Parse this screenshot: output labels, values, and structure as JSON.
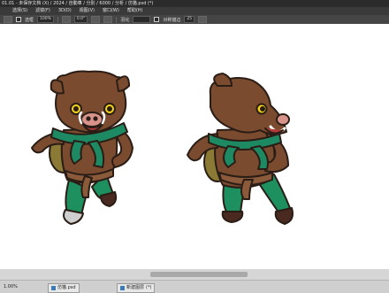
{
  "window": {
    "title": "01.01 - 未保存文档 (X) / 2024 / 自動車 / 分別 / 6000 / 分析 / 仿猫.psd (*)"
  },
  "menu": [
    "选择(S)",
    "滤镜(F)",
    "3D(D)",
    "视图(V)",
    "窗口(W)",
    "帮助(H)"
  ],
  "toolbar": {
    "mode_label": "选框",
    "size_value": "100%",
    "angle_value": "0.0°",
    "option_label": "羽化",
    "edge_label": "对称描边",
    "edge_value": "25"
  },
  "status": {
    "left_value": "1.00%",
    "tab1_label": "仿猫.psd",
    "tab2_label": "新建图层",
    "tab2_extra": "(*)"
  },
  "colors": {
    "skin": "#7a4b2e",
    "skin_light": "#a06b4a",
    "scarf": "#1e8a63",
    "pants": "#1e8f5f",
    "belt": "#8a5a3a",
    "eye": "#f2d21a",
    "outline": "#2a1d16"
  }
}
